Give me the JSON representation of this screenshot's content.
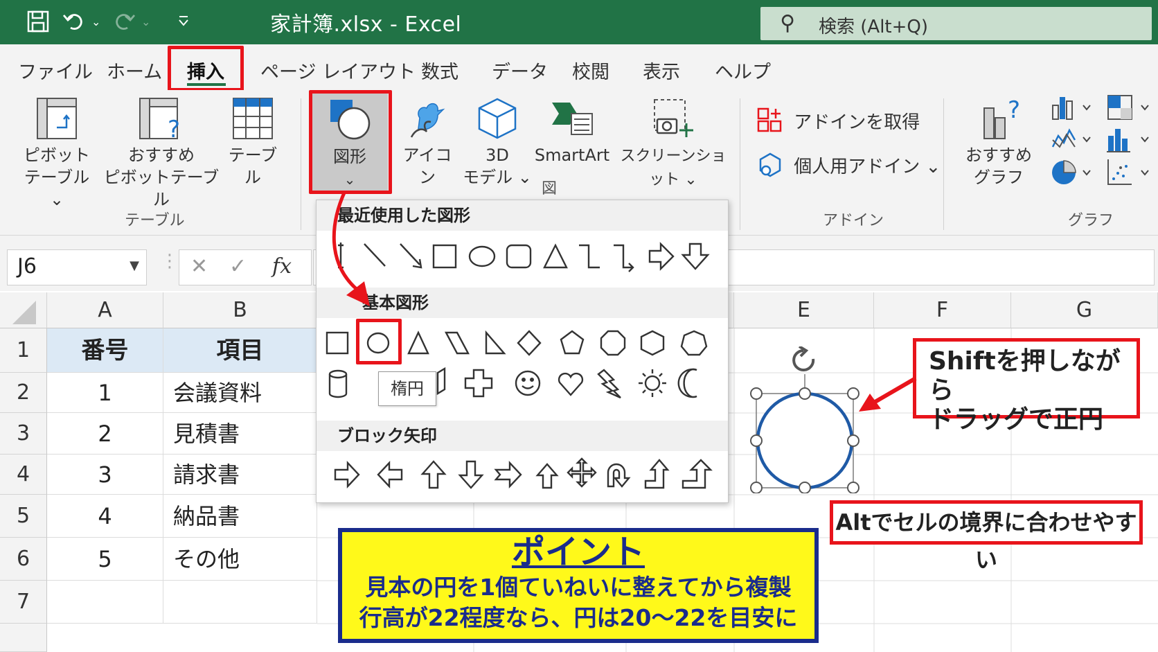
{
  "titlebar": {
    "title": "家計簿.xlsx  -  Excel",
    "search_placeholder": "検索 (Alt+Q)"
  },
  "tabs": [
    {
      "label": "ファイル"
    },
    {
      "label": "ホーム"
    },
    {
      "label": "挿入",
      "active": true
    },
    {
      "label": "ページ レイアウト"
    },
    {
      "label": "数式"
    },
    {
      "label": "データ"
    },
    {
      "label": "校閲"
    },
    {
      "label": "表示"
    },
    {
      "label": "ヘルプ"
    }
  ],
  "ribbon": {
    "pivot_line1": "ピボット",
    "pivot_line2": "テーブル ⌄",
    "recommended_pivot_line1": "おすすめ",
    "recommended_pivot_line2": "ピボットテーブル",
    "table": "テーブル",
    "group_table": "テーブル",
    "shapes": "図形",
    "shapes_caret": "⌄",
    "icons": "アイコン",
    "model3d_line1": "3D",
    "model3d_line2": "モデル ⌄",
    "smartart": "SmartArt",
    "screenshot": "スクリーンショット ⌄",
    "screenshot_caret": "⌄",
    "group_illust": "図",
    "get_addins": "アドインを取得",
    "personal_addins": "個人用アドイン  ⌄",
    "group_addins": "アドイン",
    "recommended_chart_line1": "おすすめ",
    "recommended_chart_line2": "グラフ",
    "group_chart": "グラフ",
    "accent": "#217346"
  },
  "formula_bar": {
    "name_box": "J6",
    "fx": "fx"
  },
  "columns": [
    "A",
    "B",
    "E",
    "F",
    "G"
  ],
  "rows": [
    "1",
    "2",
    "3",
    "4",
    "5",
    "6",
    "7"
  ],
  "table": {
    "headers": [
      "番号",
      "項目"
    ],
    "rows": [
      [
        "1",
        "会議資料"
      ],
      [
        "2",
        "見積書"
      ],
      [
        "3",
        "請求書"
      ],
      [
        "4",
        "納品書"
      ],
      [
        "5",
        "その他"
      ]
    ]
  },
  "shapes_menu": {
    "recent_title": "最近使用した図形",
    "basic_title": "基本図形",
    "block_arrows_title": "ブロック矢印",
    "tooltip": "楕円"
  },
  "callouts": {
    "shift_line1": "Shiftを押しながら",
    "shift_line2": "ドラッグで正円",
    "alt": "Altでセルの境界に合わせやすい",
    "point_title": "ポイント",
    "point_line1": "見本の円を1個ていねいに整えてから複製",
    "point_line2": "行高が22程度なら、円は20～22を目安に"
  }
}
